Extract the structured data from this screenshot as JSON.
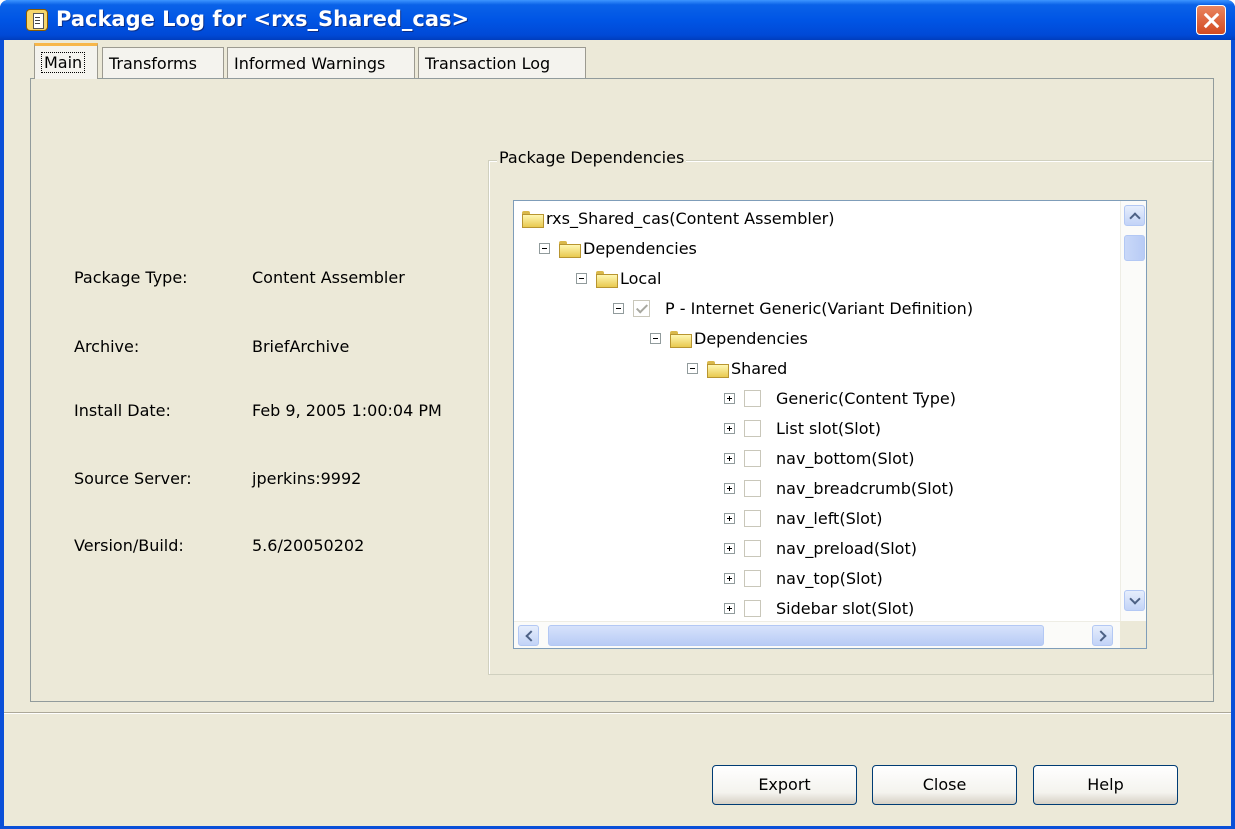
{
  "window": {
    "title": "Package Log for <rxs_Shared_cas>"
  },
  "tabs": [
    {
      "label": "Main"
    },
    {
      "label": "Transforms"
    },
    {
      "label": "Informed Warnings"
    },
    {
      "label": "Transaction Log"
    }
  ],
  "info": {
    "package_type_label": "Package Type:",
    "package_type_value": "Content Assembler",
    "archive_label": "Archive:",
    "archive_value": "BriefArchive",
    "install_date_label": "Install Date:",
    "install_date_value": "Feb 9, 2005 1:00:04 PM",
    "source_server_label": "Source Server:",
    "source_server_value": "jperkins:9992",
    "version_label": "Version/Build:",
    "version_value": "5.6/20050202"
  },
  "dependencies": {
    "legend": "Package Dependencies",
    "tree": [
      {
        "label": "rxs_Shared_cas(Content Assembler)",
        "level": 0,
        "expander": "none",
        "icon": "folder-icon"
      },
      {
        "label": "Dependencies",
        "level": 1,
        "expander": "minus",
        "icon": "folder-icon"
      },
      {
        "label": "Local",
        "level": 2,
        "expander": "minus",
        "icon": "folder-icon"
      },
      {
        "label": "P - Internet Generic(Variant Definition)",
        "level": 3,
        "expander": "minus",
        "icon": "checkbox",
        "checked": true
      },
      {
        "label": "Dependencies",
        "level": 4,
        "expander": "minus",
        "icon": "folder-icon"
      },
      {
        "label": "Shared",
        "level": 5,
        "expander": "minus",
        "icon": "folder-icon"
      },
      {
        "label": "Generic(Content Type)",
        "level": 6,
        "expander": "plus",
        "icon": "checkbox",
        "checked": false
      },
      {
        "label": "List slot(Slot)",
        "level": 6,
        "expander": "plus",
        "icon": "checkbox",
        "checked": false
      },
      {
        "label": "nav_bottom(Slot)",
        "level": 6,
        "expander": "plus",
        "icon": "checkbox",
        "checked": false
      },
      {
        "label": "nav_breadcrumb(Slot)",
        "level": 6,
        "expander": "plus",
        "icon": "checkbox",
        "checked": false
      },
      {
        "label": "nav_left(Slot)",
        "level": 6,
        "expander": "plus",
        "icon": "checkbox",
        "checked": false
      },
      {
        "label": "nav_preload(Slot)",
        "level": 6,
        "expander": "plus",
        "icon": "checkbox",
        "checked": false
      },
      {
        "label": "nav_top(Slot)",
        "level": 6,
        "expander": "plus",
        "icon": "checkbox",
        "checked": false
      },
      {
        "label": "Sidebar slot(Slot)",
        "level": 6,
        "expander": "plus",
        "icon": "checkbox",
        "checked": false
      }
    ]
  },
  "buttons": {
    "export": "Export",
    "close": "Close",
    "help": "Help"
  }
}
